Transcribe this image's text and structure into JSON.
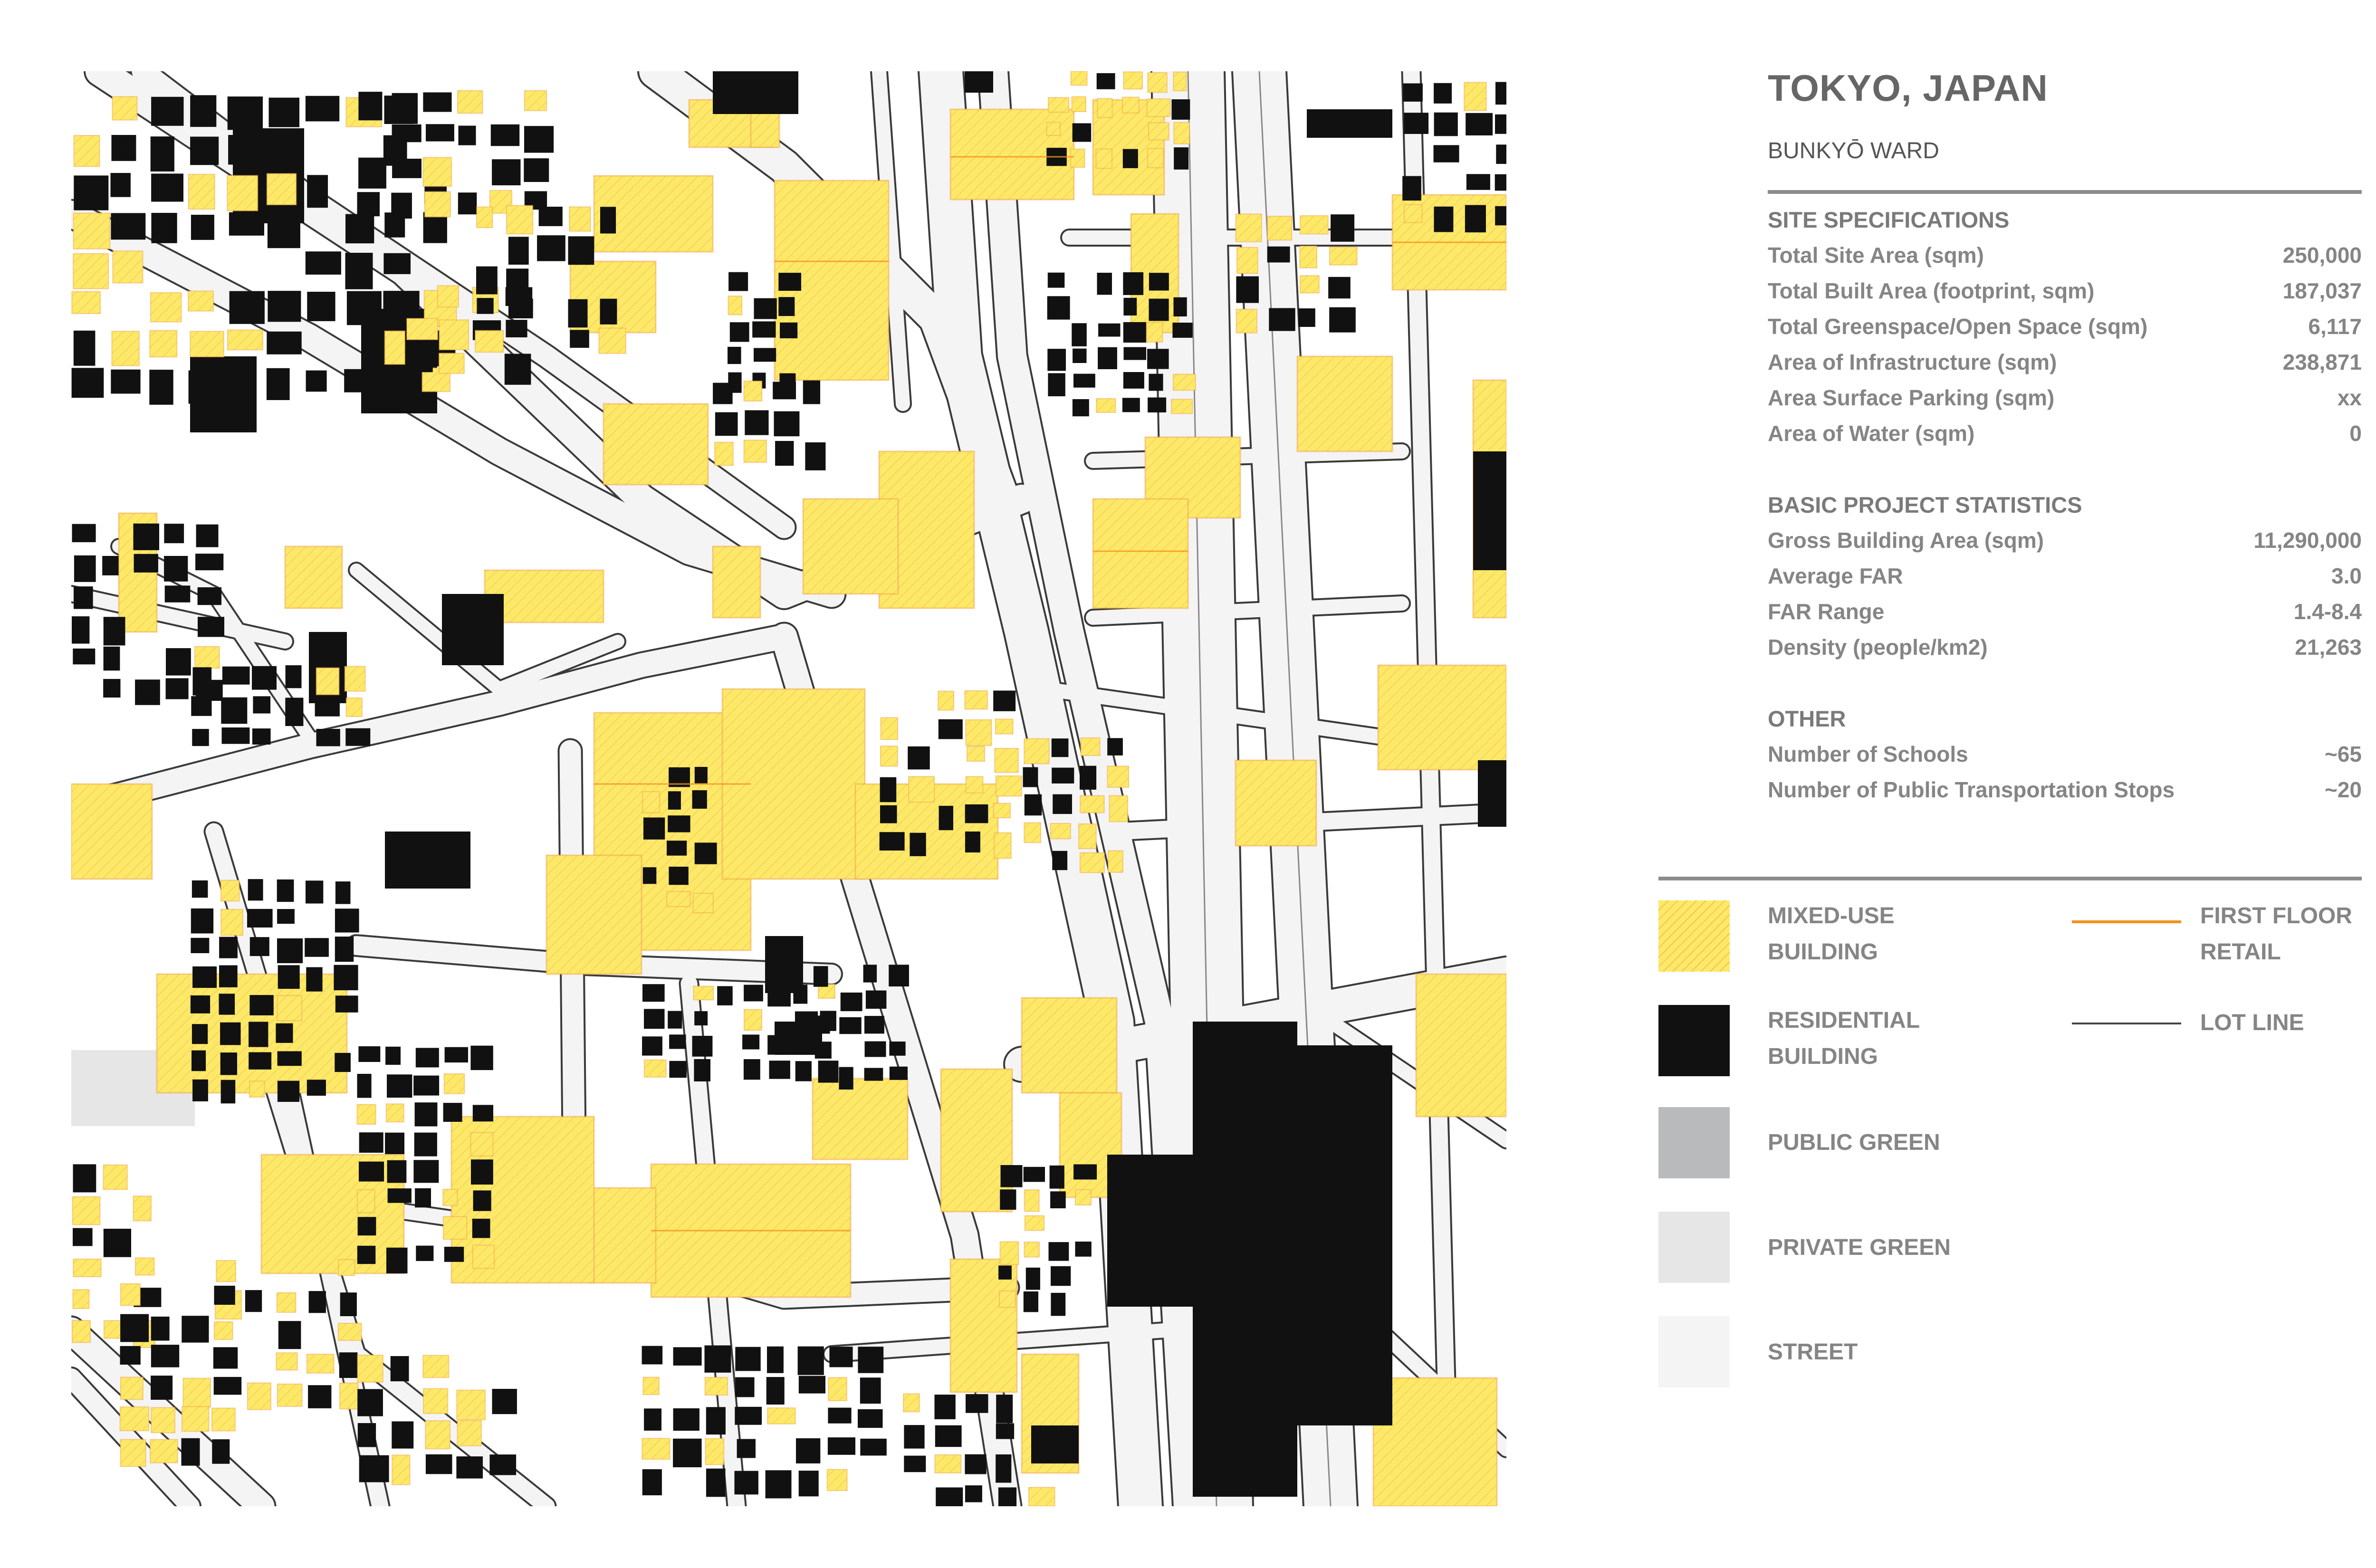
{
  "header": {
    "title": "TOKYO, JAPAN",
    "subtitle": "BUNKYŌ WARD"
  },
  "site_specifications": {
    "heading": "SITE SPECIFICATIONS",
    "rows": [
      {
        "label": "Total Site Area (sqm)",
        "value": "250,000"
      },
      {
        "label": "Total Built Area (footprint, sqm)",
        "value": "187,037"
      },
      {
        "label": "Total Greenspace/Open Space (sqm)",
        "value": "6,117"
      },
      {
        "label": "Area of Infrastructure (sqm)",
        "value": "238,871"
      },
      {
        "label": "Area Surface Parking (sqm)",
        "value": "xx"
      },
      {
        "label": "Area of Water (sqm)",
        "value": "0"
      }
    ]
  },
  "project_statistics": {
    "heading": "BASIC PROJECT STATISTICS",
    "rows": [
      {
        "label": "Gross Building Area (sqm)",
        "value": "11,290,000"
      },
      {
        "label": "Average FAR",
        "value": "3.0"
      },
      {
        "label": "FAR Range",
        "value": "1.4-8.4"
      },
      {
        "label": "Density (people/km2)",
        "value": "21,263"
      }
    ]
  },
  "other": {
    "heading": "OTHER",
    "rows": [
      {
        "label": "Number of Schools",
        "value": "~65"
      },
      {
        "label": "Number of Public Transportation Stops",
        "value": "~20"
      }
    ]
  },
  "legend": {
    "mixed_use_1": "MIXED-USE",
    "mixed_use_2": "BUILDING",
    "residential_1": "RESIDENTIAL",
    "residential_2": "BUILDING",
    "public_green": "PUBLIC GREEN",
    "private_green": "PRIVATE GREEN",
    "street": "STREET",
    "first_floor_1": "FIRST FLOOR",
    "first_floor_2": "RETAIL",
    "lot_line": "LOT LINE"
  },
  "colors": {
    "mixed_use": "#fde968",
    "mixed_use_hatch": "#f0a046",
    "residential": "#111111",
    "public_green": "#b9babc",
    "private_green": "#e6e6e6",
    "street": "#f4f4f5",
    "retail_line": "#f5921e",
    "lot_line": "#444444"
  },
  "map": {
    "icons": [
      "building-footprint",
      "street-network",
      "lot-line"
    ]
  }
}
